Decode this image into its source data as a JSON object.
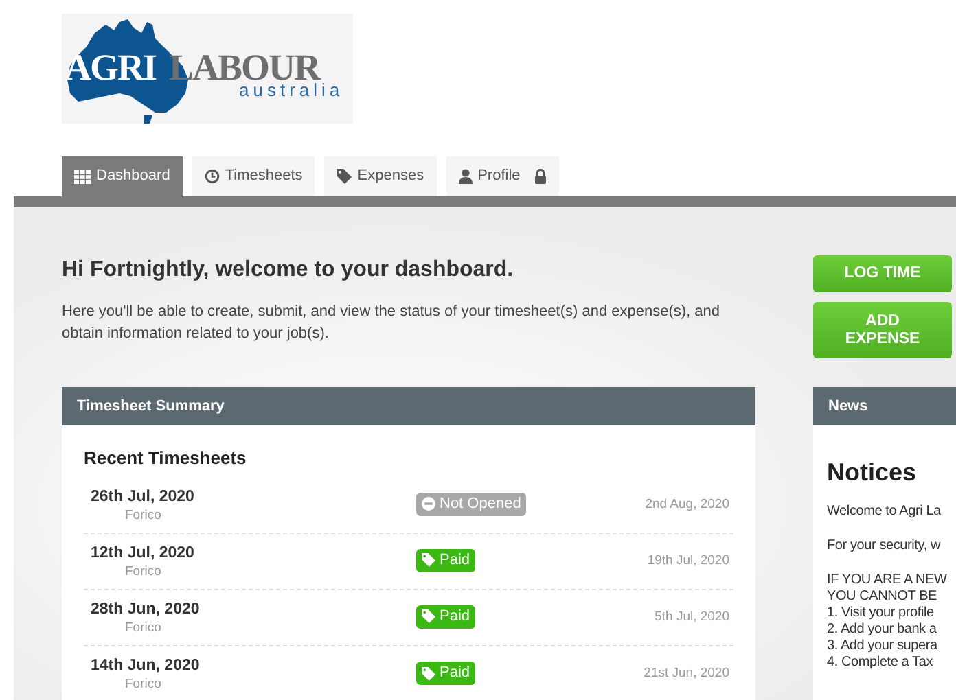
{
  "logo": {
    "word_1": "AGRI",
    "word_2": "LABOUR",
    "word_3": "australia"
  },
  "tabs": [
    {
      "label": "Dashboard",
      "selected": true
    },
    {
      "label": "Timesheets",
      "selected": false
    },
    {
      "label": "Expenses",
      "selected": false
    },
    {
      "label": "Profile",
      "locked": true,
      "selected": false
    }
  ],
  "welcome": {
    "heading": "Hi Fortnightly, welcome to your dashboard.",
    "text": "Here you'll be able to create, submit, and view the status of your timesheet(s) and expense(s), and obtain information related to your job(s)."
  },
  "timesheet_summary": {
    "title": "Timesheet Summary",
    "subtitle": "Recent Timesheets",
    "rows": [
      {
        "week": "26th Jul, 2020",
        "client": "Forico",
        "status": "Not Opened",
        "kind": "not_opened",
        "date": "2nd Aug, 2020"
      },
      {
        "week": "12th Jul, 2020",
        "client": "Forico",
        "status": "Paid",
        "kind": "paid",
        "date": "19th Jul, 2020"
      },
      {
        "week": "28th Jun, 2020",
        "client": "Forico",
        "status": "Paid",
        "kind": "paid",
        "date": "5th Jul, 2020"
      },
      {
        "week": "14th Jun, 2020",
        "client": "Forico",
        "status": "Paid",
        "kind": "paid",
        "date": "21st Jun, 2020"
      }
    ]
  },
  "actions": [
    "LOG TIME",
    "ADD EXPENSE"
  ],
  "news": {
    "title": "News",
    "heading": "Notices",
    "paragraphs": [
      [
        "Welcome to Agri La"
      ],
      [
        "For your security, w"
      ],
      [
        "IF YOU ARE A NEW",
        "YOU CANNOT BE",
        "1. Visit your profile",
        "2. Add your bank a",
        "3. Add your supera",
        "4. Complete a Tax"
      ]
    ]
  }
}
